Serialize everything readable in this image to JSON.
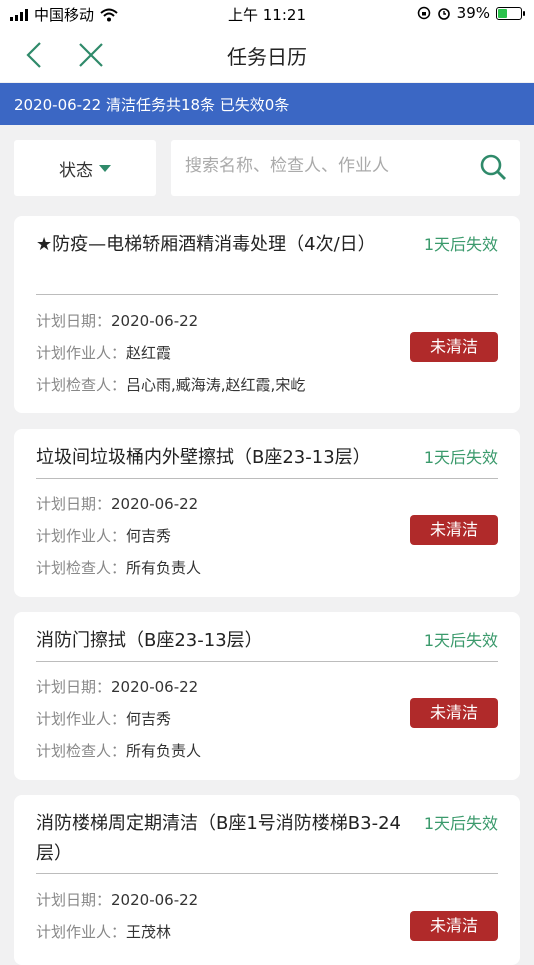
{
  "status_bar": {
    "carrier": "中国移动",
    "time": "上午 11:21",
    "battery": "39%",
    "battery_level": 0.39
  },
  "nav": {
    "title": "任务日历"
  },
  "banner": {
    "text": "2020-06-22 清洁任务共18条 已失效0条"
  },
  "filter": {
    "status_label": "状态",
    "search_placeholder": "搜索名称、检查人、作业人"
  },
  "labels": {
    "plan_date": "计划日期：",
    "plan_worker": "计划作业人：",
    "plan_checker": "计划检查人："
  },
  "tasks": [
    {
      "title": "★防疫—电梯轿厢酒精消毒处理（4次/日）",
      "expire": "1天后失效",
      "date": "2020-06-22",
      "worker": "赵红霞",
      "checker": "吕心雨,臧海涛,赵红霞,宋屹",
      "status": "未清洁"
    },
    {
      "title": "垃圾间垃圾桶内外壁擦拭（B座23-13层）",
      "expire": "1天后失效",
      "date": "2020-06-22",
      "worker": "何吉秀",
      "checker": "所有负责人",
      "status": "未清洁"
    },
    {
      "title": "消防门擦拭（B座23-13层）",
      "expire": "1天后失效",
      "date": "2020-06-22",
      "worker": "何吉秀",
      "checker": "所有负责人",
      "status": "未清洁"
    },
    {
      "title": "消防楼梯周定期清洁（B座1号消防楼梯B3-24层）",
      "expire": "1天后失效",
      "date": "2020-06-22",
      "worker": "王茂林",
      "checker": "",
      "status": "未清洁"
    }
  ]
}
